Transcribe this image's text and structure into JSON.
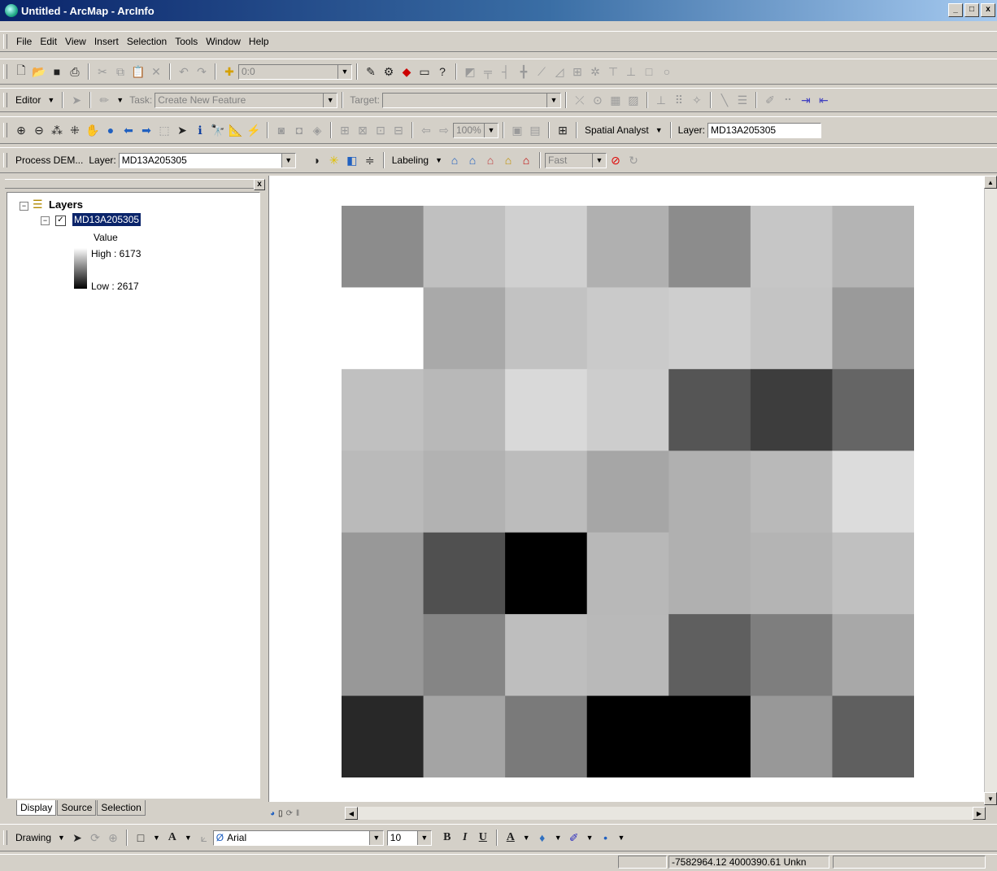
{
  "window": {
    "title": "Untitled - ArcMap - ArcInfo",
    "controls": [
      "_",
      "□",
      "x"
    ]
  },
  "menu": [
    "File",
    "Edit",
    "View",
    "Insert",
    "Selection",
    "Tools",
    "Window",
    "Help"
  ],
  "standard_toolbar": {
    "scale_value": "0:0"
  },
  "editor_toolbar": {
    "editor_label": "Editor",
    "task_label": "Task:",
    "task_value": "Create New Feature",
    "target_label": "Target:",
    "target_value": ""
  },
  "tools_toolbar": {
    "zoom_value": "100%",
    "spatial_analyst_label": "Spatial Analyst",
    "layer_label": "Layer:",
    "layer_value": "MD13A205305"
  },
  "process_toolbar": {
    "process_label": "Process DEM...",
    "layer_label": "Layer:",
    "layer_value": "MD13A205305",
    "labeling_label": "Labeling",
    "fast_value": "Fast"
  },
  "toc": {
    "root_label": "Layers",
    "layer_name": "MD13A205305",
    "legend_title": "Value",
    "high_label": "High : 6173",
    "low_label": "Low : 2617",
    "tabs": [
      "Display",
      "Source",
      "Selection"
    ]
  },
  "raster": {
    "rows": 7,
    "cols": 7,
    "cell_colors": [
      [
        "#8c8c8c",
        "#c0c0c0",
        "#d0d0d0",
        "#b0b0b0",
        "#8c8c8c",
        "#c6c6c6",
        "#b4b4b4"
      ],
      [
        "#ffffff",
        "#a9a9a9",
        "#c2c2c2",
        "#cacaca",
        "#cecece",
        "#c4c4c4",
        "#9a9a9a"
      ],
      [
        "#c0c0c0",
        "#b8b8b8",
        "#d9d9d9",
        "#cdcdcd",
        "#555555",
        "#3d3d3d",
        "#656565"
      ],
      [
        "#bababa",
        "#b2b2b2",
        "#bcbcbc",
        "#a6a6a6",
        "#b0b0b0",
        "#b9b9b9",
        "#dcdcdc"
      ],
      [
        "#989898",
        "#505050",
        "#000000",
        "#b8b8b8",
        "#b0b0b0",
        "#b4b4b4",
        "#c0c0c0"
      ],
      [
        "#989898",
        "#858585",
        "#bebebe",
        "#b9b9b9",
        "#5f5f5f",
        "#7e7e7e",
        "#a8a8a8"
      ],
      [
        "#282828",
        "#a4a4a4",
        "#7a7a7a",
        "#000000",
        "#000000",
        "#989898",
        "#5f5f5f"
      ]
    ]
  },
  "drawing_toolbar": {
    "drawing_label": "Drawing",
    "font_value": "Arial",
    "size_value": "10",
    "bold": "B",
    "italic": "I",
    "underline": "U"
  },
  "status": {
    "coords": "-7582964.12  4000390.61 Unkn"
  }
}
